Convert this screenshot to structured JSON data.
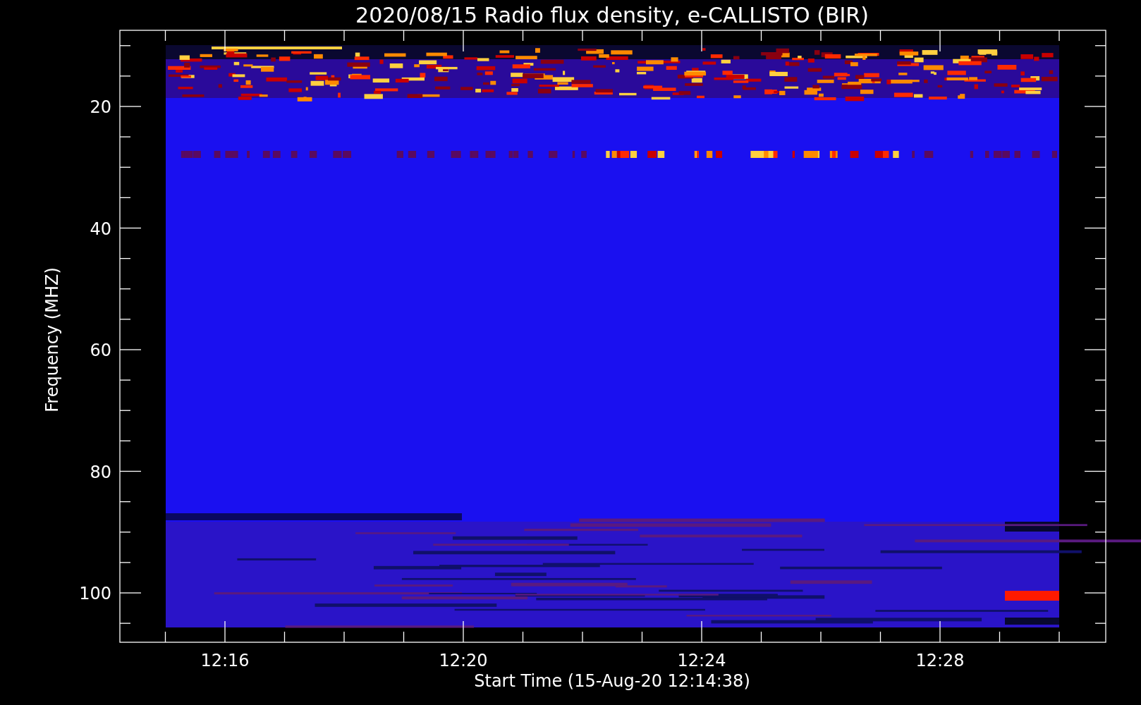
{
  "title": "2020/08/15  Radio flux density, e-CALLISTO (BIR)",
  "y_axis": {
    "label": "Frequency (MHZ)",
    "ticks": [
      "20",
      "40",
      "60",
      "80",
      "100"
    ]
  },
  "x_axis": {
    "label": "Start Time (15-Aug-20 12:14:38)",
    "ticks": [
      "12:16",
      "12:20",
      "12:24",
      "12:28"
    ]
  }
}
